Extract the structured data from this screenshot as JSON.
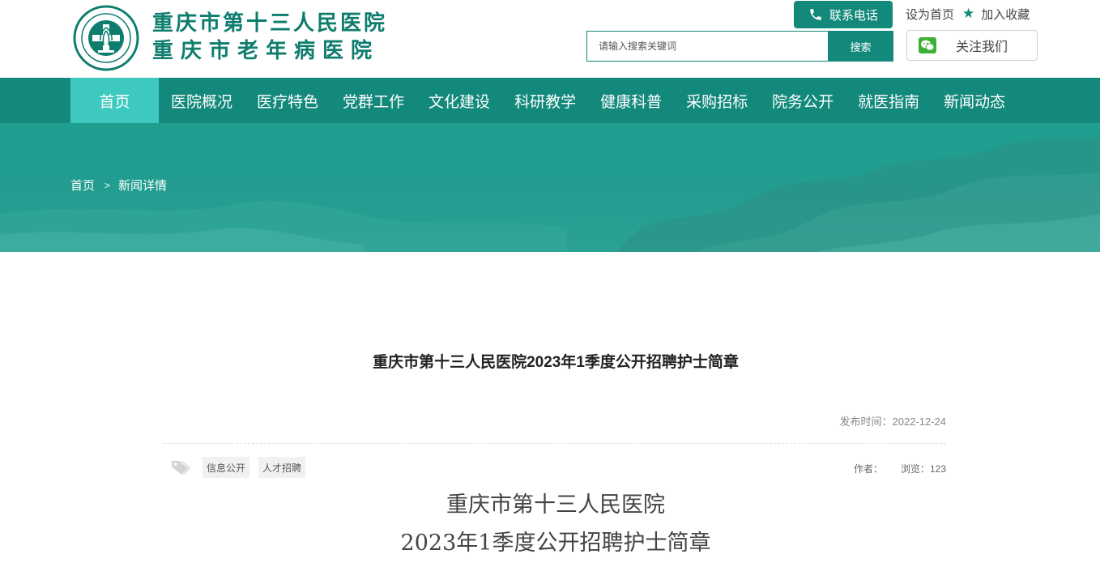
{
  "header": {
    "logo_line1": "重庆市第十三人民医院",
    "logo_line2": "重庆市老年病医院",
    "phone_label": "联系电话",
    "set_home_label": "设为首页",
    "add_favorite_label": "加入收藏",
    "search_placeholder": "请输入搜索关键词",
    "search_button": "搜索",
    "follow_label": "关注我们"
  },
  "nav": {
    "items": [
      {
        "label": "首页"
      },
      {
        "label": "医院概况"
      },
      {
        "label": "医疗特色"
      },
      {
        "label": "党群工作"
      },
      {
        "label": "文化建设"
      },
      {
        "label": "科研教学"
      },
      {
        "label": "健康科普"
      },
      {
        "label": "采购招标"
      },
      {
        "label": "院务公开"
      },
      {
        "label": "就医指南"
      },
      {
        "label": "新闻动态"
      }
    ],
    "active_index": 0
  },
  "breadcrumb": {
    "home": "首页",
    "separator": ">",
    "current": "新闻详情"
  },
  "article": {
    "title": "重庆市第十三人民医院2023年1季度公开招聘护士简章",
    "publish_time": "发布时间：2022-12-24",
    "tags": [
      "信息公开",
      "人才招聘"
    ],
    "author_label": "作者：",
    "views_label": "浏览：123",
    "body_heading_line1": "重庆市第十三人民医院",
    "body_heading_line2": "2023年1季度公开招聘护士简章"
  },
  "colors": {
    "brand": "#13897b",
    "nav_active": "#3ec9c0",
    "banner": "#229d90"
  }
}
